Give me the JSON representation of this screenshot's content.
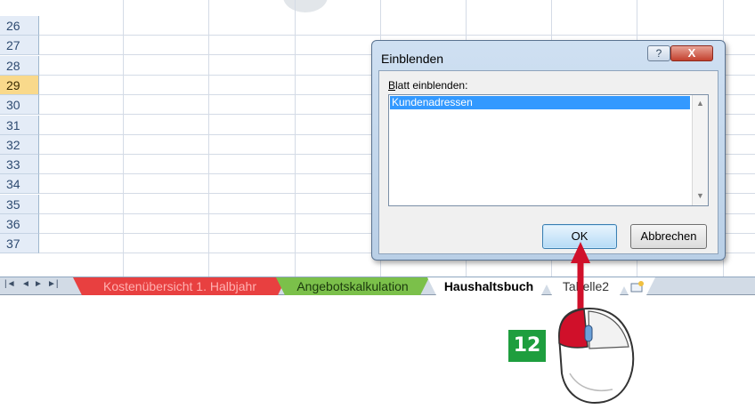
{
  "spreadsheet": {
    "row_numbers": [
      "26",
      "27",
      "28",
      "29",
      "30",
      "31",
      "32",
      "33",
      "34",
      "35",
      "36",
      "37"
    ],
    "selected_row": "29"
  },
  "sheet_tabs": {
    "nav_buttons": [
      "|◄",
      "◄",
      "►",
      "►|"
    ],
    "tabs": [
      {
        "label": "Kostenübersicht 1. Halbjahr",
        "color": "#e84040",
        "active": false
      },
      {
        "label": "Angebotskalkulation",
        "color": "#7bc04a",
        "active": false
      },
      {
        "label": "Haushaltsbuch",
        "color": "#ffffff",
        "active": true
      },
      {
        "label": "Tabelle2",
        "color": "#ffffff",
        "active": false
      }
    ],
    "insert_tab_icon": "new-sheet-icon"
  },
  "dialog": {
    "title": "Einblenden",
    "help_label": "?",
    "close_label": "X",
    "list_label_underlined": "B",
    "list_label_rest": "latt einblenden:",
    "items": [
      "Kundenadressen"
    ],
    "selected_index": 0,
    "ok_label": "OK",
    "cancel_label": "Abbrechen"
  },
  "annotation": {
    "step_number": "12",
    "badge_color": "#1e9e3e",
    "arrow_color": "#d0102a",
    "mouse_icon": "mouse-left-click-icon"
  }
}
